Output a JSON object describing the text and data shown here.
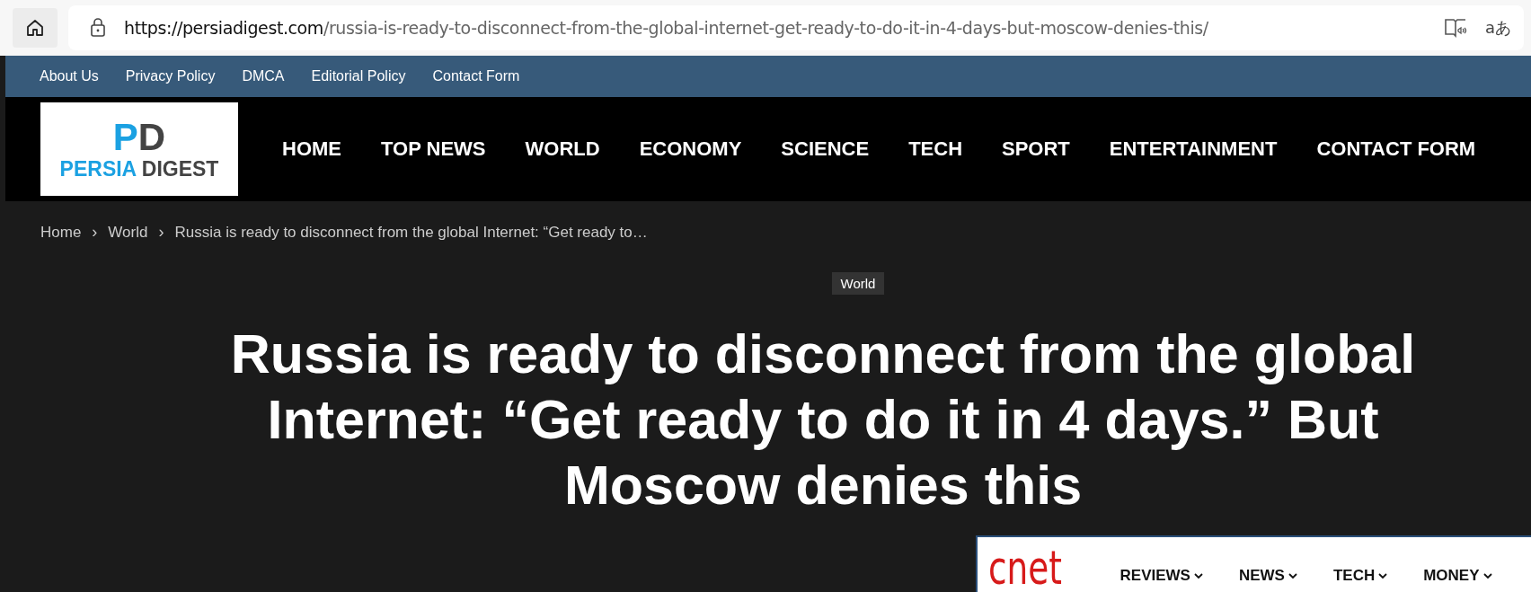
{
  "browser": {
    "url_host": "https://persiadigest.com",
    "url_path": "/russia-is-ready-to-disconnect-from-the-global-internet-get-ready-to-do-it-in-4-days-but-moscow-denies-this/",
    "translate_glyph": "aあ"
  },
  "top_links": [
    "About Us",
    "Privacy Policy",
    "DMCA",
    "Editorial Policy",
    "Contact Form"
  ],
  "logo": {
    "mark_p": "P",
    "mark_d": "D",
    "word_1": "PERSIA",
    "word_2": "DIGEST"
  },
  "nav": [
    "HOME",
    "TOP NEWS",
    "WORLD",
    "ECONOMY",
    "SCIENCE",
    "TECH",
    "SPORT",
    "ENTERTAINMENT",
    "CONTACT FORM"
  ],
  "breadcrumb": {
    "separator": "›",
    "items": [
      "Home",
      "World",
      "Russia is ready to disconnect from the global Internet: “Get ready to…"
    ]
  },
  "article": {
    "category": "World",
    "headline": "Russia is ready to disconnect from the global Internet: “Get ready to do it in 4 days.” But Moscow denies this"
  },
  "overlay": {
    "logo": "cnet",
    "nav": [
      "REVIEWS",
      "NEWS",
      "TECH",
      "MONEY"
    ]
  }
}
